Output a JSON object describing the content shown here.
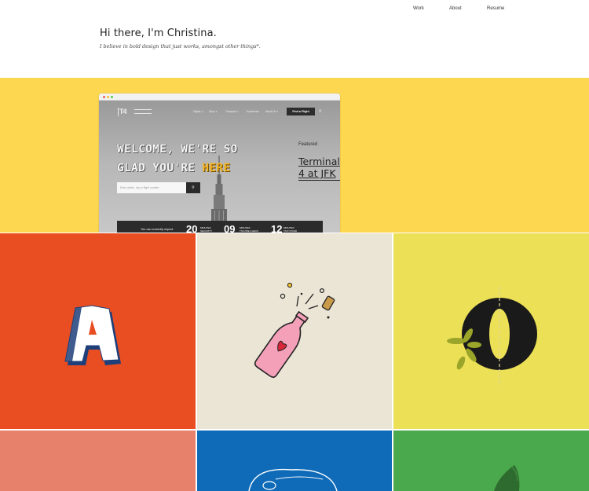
{
  "nav": {
    "work": "Work",
    "about": "About",
    "resume": "Resume"
  },
  "intro": {
    "title": "Hi there, I'm Christina.",
    "tagline": "I believe in bold design that just works, amongst other things*."
  },
  "featured": {
    "label": "Featured",
    "title": "Terminal 4 at JFK",
    "screenshot": {
      "menu": [
        "Flights ∨",
        "Shop ∨",
        "Transport ∨",
        "Experience",
        "About Us ∨"
      ],
      "find_button": "Find a Flight",
      "headline_line1": "WELCOME, WE'RE SO",
      "headline_line2_a": "GLAD YOU'RE ",
      "headline_line2_b": "HERE",
      "search_placeholder": "Enter airline, city or flight number",
      "expect_text": "You can currently expect",
      "stats": [
        {
          "value": "20",
          "caption_1": "MINUTES",
          "caption_2": "SECURITY"
        },
        {
          "value": "09",
          "caption_1": "MINUTES",
          "caption_2": "TSA PRE-CHECK"
        },
        {
          "value": "12",
          "caption_1": "MINUTES",
          "caption_2": "TAXI STAND"
        }
      ]
    }
  },
  "tiles": [
    {
      "id": "letter-a",
      "color": "#e94e22"
    },
    {
      "id": "champagne",
      "color": "#ebe5d5"
    },
    {
      "id": "letter-o",
      "color": "#ece056"
    },
    {
      "id": "salmon",
      "color": "#e8816b"
    },
    {
      "id": "globe",
      "color": "#0f6bb8"
    },
    {
      "id": "leaf",
      "color": "#4aa84d"
    }
  ],
  "icons": {
    "search": "search-icon",
    "letter_a": "letter-a-illustration",
    "bottle": "champagne-bottle-illustration",
    "letter_o": "letter-o-illustration",
    "globe": "globe-illustration",
    "leaf": "leaf-illustration"
  }
}
